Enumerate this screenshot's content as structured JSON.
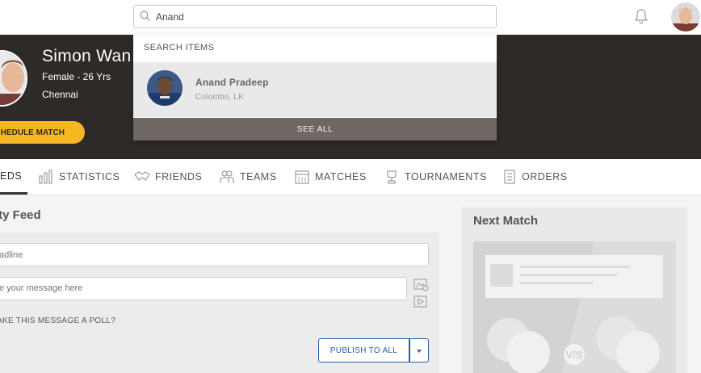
{
  "search": {
    "value": "Anand",
    "placeholder": "Search"
  },
  "profile": {
    "name": "Simon Wan",
    "meta": "Female - 26 Yrs",
    "city": "Chennai",
    "schedule_label": "HEDULE MATCH"
  },
  "tabs": [
    {
      "label": "EDS",
      "icon": "feed-icon"
    },
    {
      "label": "STATISTICS",
      "icon": "bar-chart-icon"
    },
    {
      "label": "FRIENDS",
      "icon": "handshake-icon"
    },
    {
      "label": "TEAMS",
      "icon": "team-icon"
    },
    {
      "label": "MATCHES",
      "icon": "calendar-icon"
    },
    {
      "label": "TOURNAMENTS",
      "icon": "trophy-icon"
    },
    {
      "label": "ORDERS",
      "icon": "receipt-icon"
    }
  ],
  "feed": {
    "title": "ity Feed",
    "headline_placeholder": "adline",
    "message_placeholder": "e your message here",
    "poll_label": "AKE THIS MESSAGE A POLL?",
    "publish_label": "PUBLISH TO ALL"
  },
  "next_match": {
    "title": "Next Match",
    "vs_label": "V/S"
  },
  "dropdown": {
    "header": "SEARCH ITEMS",
    "items": [
      {
        "name": "Anand Pradeep",
        "location": "Colombo, LK"
      }
    ],
    "see_all": "SEE ALL"
  },
  "colors": {
    "accent": "#f5b723",
    "banner": "#2e2a27",
    "primary": "#2a5fa8"
  }
}
